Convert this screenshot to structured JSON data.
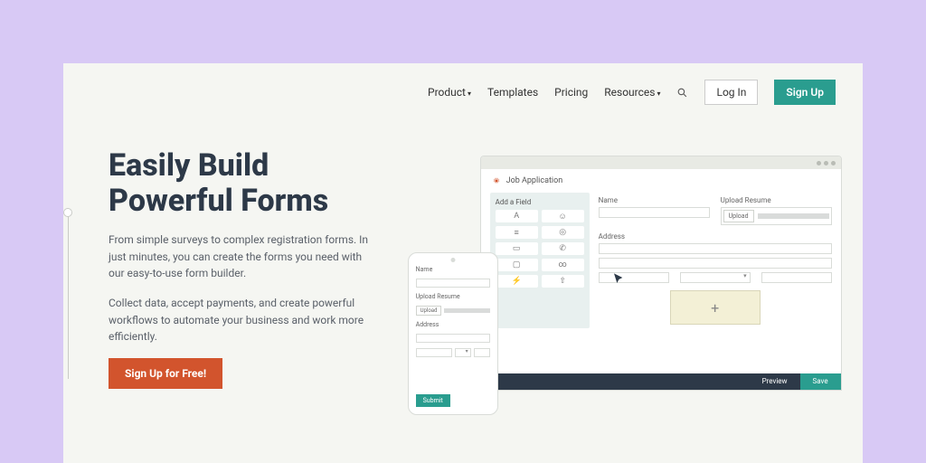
{
  "nav": {
    "product": "Product",
    "templates": "Templates",
    "pricing": "Pricing",
    "resources": "Resources",
    "login": "Log In",
    "signup": "Sign Up"
  },
  "hero": {
    "headline_l1": "Easily Build",
    "headline_l2": "Powerful Forms",
    "sub1": "From simple surveys to complex registration forms. In just minutes, you can create the forms you need with our easy-to-use form builder.",
    "sub2": "Collect data, accept payments, and create powerful workflows to automate your business and work more efficiently.",
    "cta": "Sign Up for Free!"
  },
  "builder": {
    "title": "Job Application",
    "palette_title": "Add a Field",
    "name": "Name",
    "upload_resume": "Upload Resume",
    "upload_btn": "Upload",
    "address": "Address",
    "preview": "Preview",
    "save": "Save",
    "submit": "Submit",
    "plus": "+"
  },
  "icons": {
    "A": "A"
  }
}
